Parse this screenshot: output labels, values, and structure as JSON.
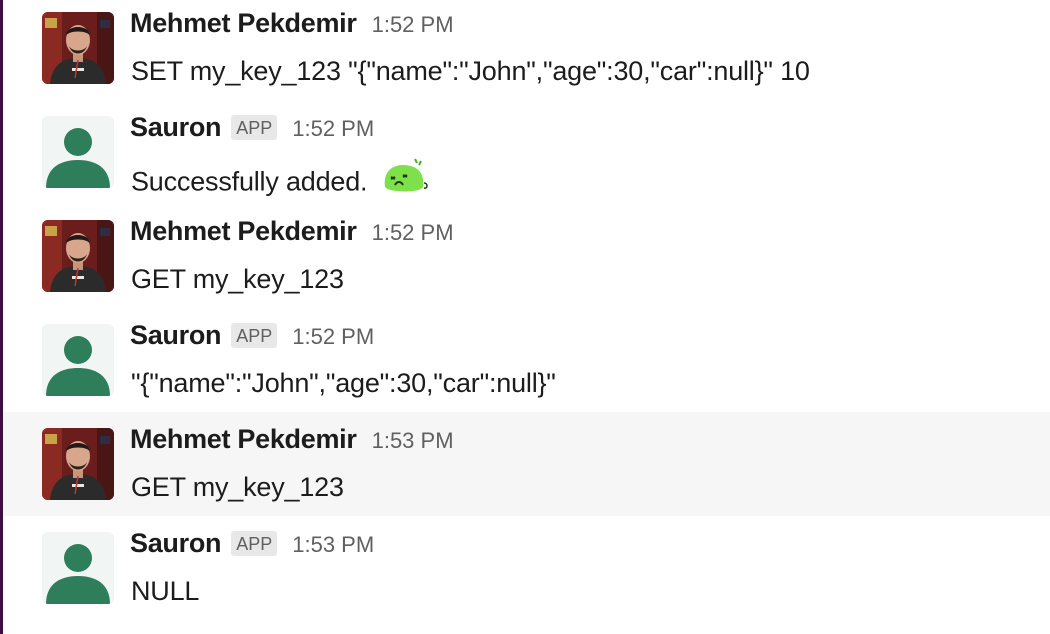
{
  "messages": [
    {
      "sender": "Mehmet Pekdemir",
      "is_app": false,
      "time": "1:52 PM",
      "text": "SET my_key_123 \"{\"name\":\"John\",\"age\":30,\"car\":null}\" 10"
    },
    {
      "sender": "Sauron",
      "is_app": true,
      "badge": "APP",
      "time": "1:52 PM",
      "text": "Successfully added.",
      "emoji": "green-blob-emoji"
    },
    {
      "sender": "Mehmet Pekdemir",
      "is_app": false,
      "time": "1:52 PM",
      "text": "GET my_key_123"
    },
    {
      "sender": "Sauron",
      "is_app": true,
      "badge": "APP",
      "time": "1:52 PM",
      "text": "\"{\"name\":\"John\",\"age\":30,\"car\":null}\""
    },
    {
      "sender": "Mehmet Pekdemir",
      "is_app": false,
      "time": "1:53 PM",
      "text": "GET my_key_123"
    },
    {
      "sender": "Sauron",
      "is_app": true,
      "badge": "APP",
      "time": "1:53 PM",
      "text": "NULL"
    }
  ],
  "colors": {
    "bot_avatar_fg": "#2e7d5b",
    "bot_avatar_bg": "#f1f5f4",
    "hover_row_bg": "#f6f6f6",
    "sidebar_edge": "#3f0e40",
    "emoji_green": "#7ee04a"
  },
  "icons": {
    "user_avatar": "user-photo-avatar",
    "bot_avatar": "default-person-avatar"
  }
}
